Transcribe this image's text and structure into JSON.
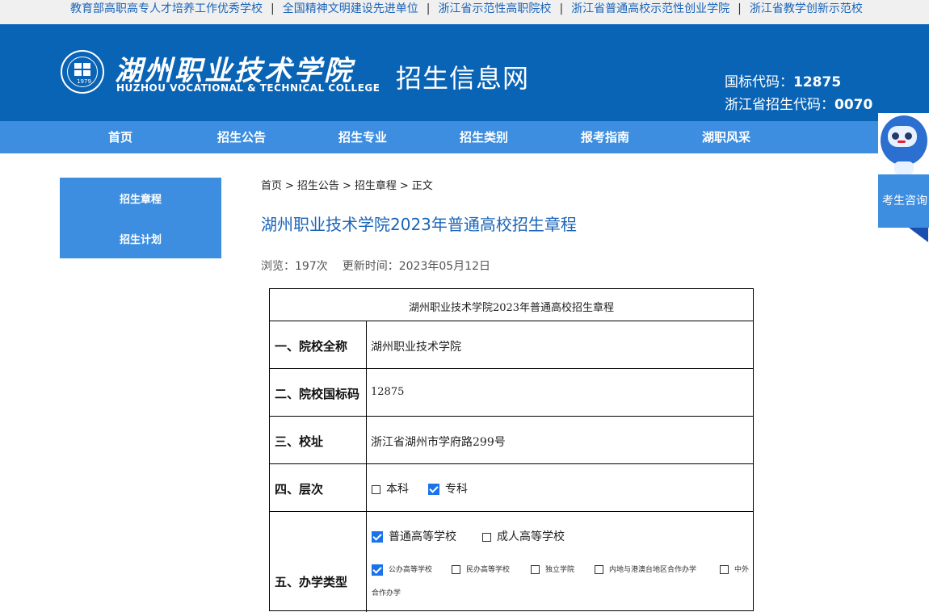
{
  "topbar": {
    "items": [
      "教育部高职高专人才培养工作优秀学校",
      "全国精神文明建设先进单位",
      "浙江省示范性高职院校",
      "浙江省普通高校示范性创业学院",
      "浙江省教学创新示范校"
    ],
    "separator": "|"
  },
  "header": {
    "logo_cn": "湖州职业技术学院",
    "logo_en": "HUZHOU VOCATIONAL & TECHNICAL COLLEGE",
    "logo_year": "1979",
    "site_title": "招生信息网",
    "code_national_label": "国标代码：",
    "code_national": "12875",
    "code_province_label": "浙江省招生代码：",
    "code_province": "0070"
  },
  "nav": [
    "首页",
    "招生公告",
    "招生专业",
    "招生类别",
    "报考指南",
    "湖职风采"
  ],
  "side": [
    "招生章程",
    "招生计划"
  ],
  "breadcrumb": [
    "首页",
    "招生公告",
    "招生章程",
    "正文"
  ],
  "breadcrumb_sep": ">",
  "article": {
    "title": "湖州职业技术学院2023年普通高校招生章程",
    "views": "浏览：197次",
    "updated": "更新时间：2023年05月12日"
  },
  "table": {
    "caption": "湖州职业技术学院2023年普通高校招生章程",
    "rows": [
      {
        "label": "一、院校全称",
        "value": "湖州职业技术学院"
      },
      {
        "label": "二、院校国标码",
        "value": "12875"
      },
      {
        "label": "三、校址",
        "value": "浙江省湖州市学府路299号"
      },
      {
        "label": "四、层次",
        "options": [
          {
            "text": "本科",
            "checked": false
          },
          {
            "text": "专科",
            "checked": true
          }
        ]
      },
      {
        "label": "五、办学类型",
        "options": [
          {
            "text": "普通高等学校",
            "checked": true
          },
          {
            "text": "成人高等学校",
            "checked": false
          }
        ],
        "sub_options": [
          {
            "text": "公办高等学校",
            "checked": true
          },
          {
            "text": "民办高等学校",
            "checked": false
          },
          {
            "text": "独立学院",
            "checked": false
          },
          {
            "text": "内地与港澳台地区合作办学",
            "checked": false
          },
          {
            "text": "中外",
            "checked": false
          }
        ],
        "sub_wrap": "合作办学"
      }
    ]
  },
  "float": {
    "label": "考生咨询"
  },
  "colors": {
    "brand": "#0a64b6",
    "nav": "#3d8ee0",
    "link": "#1a64b8"
  }
}
